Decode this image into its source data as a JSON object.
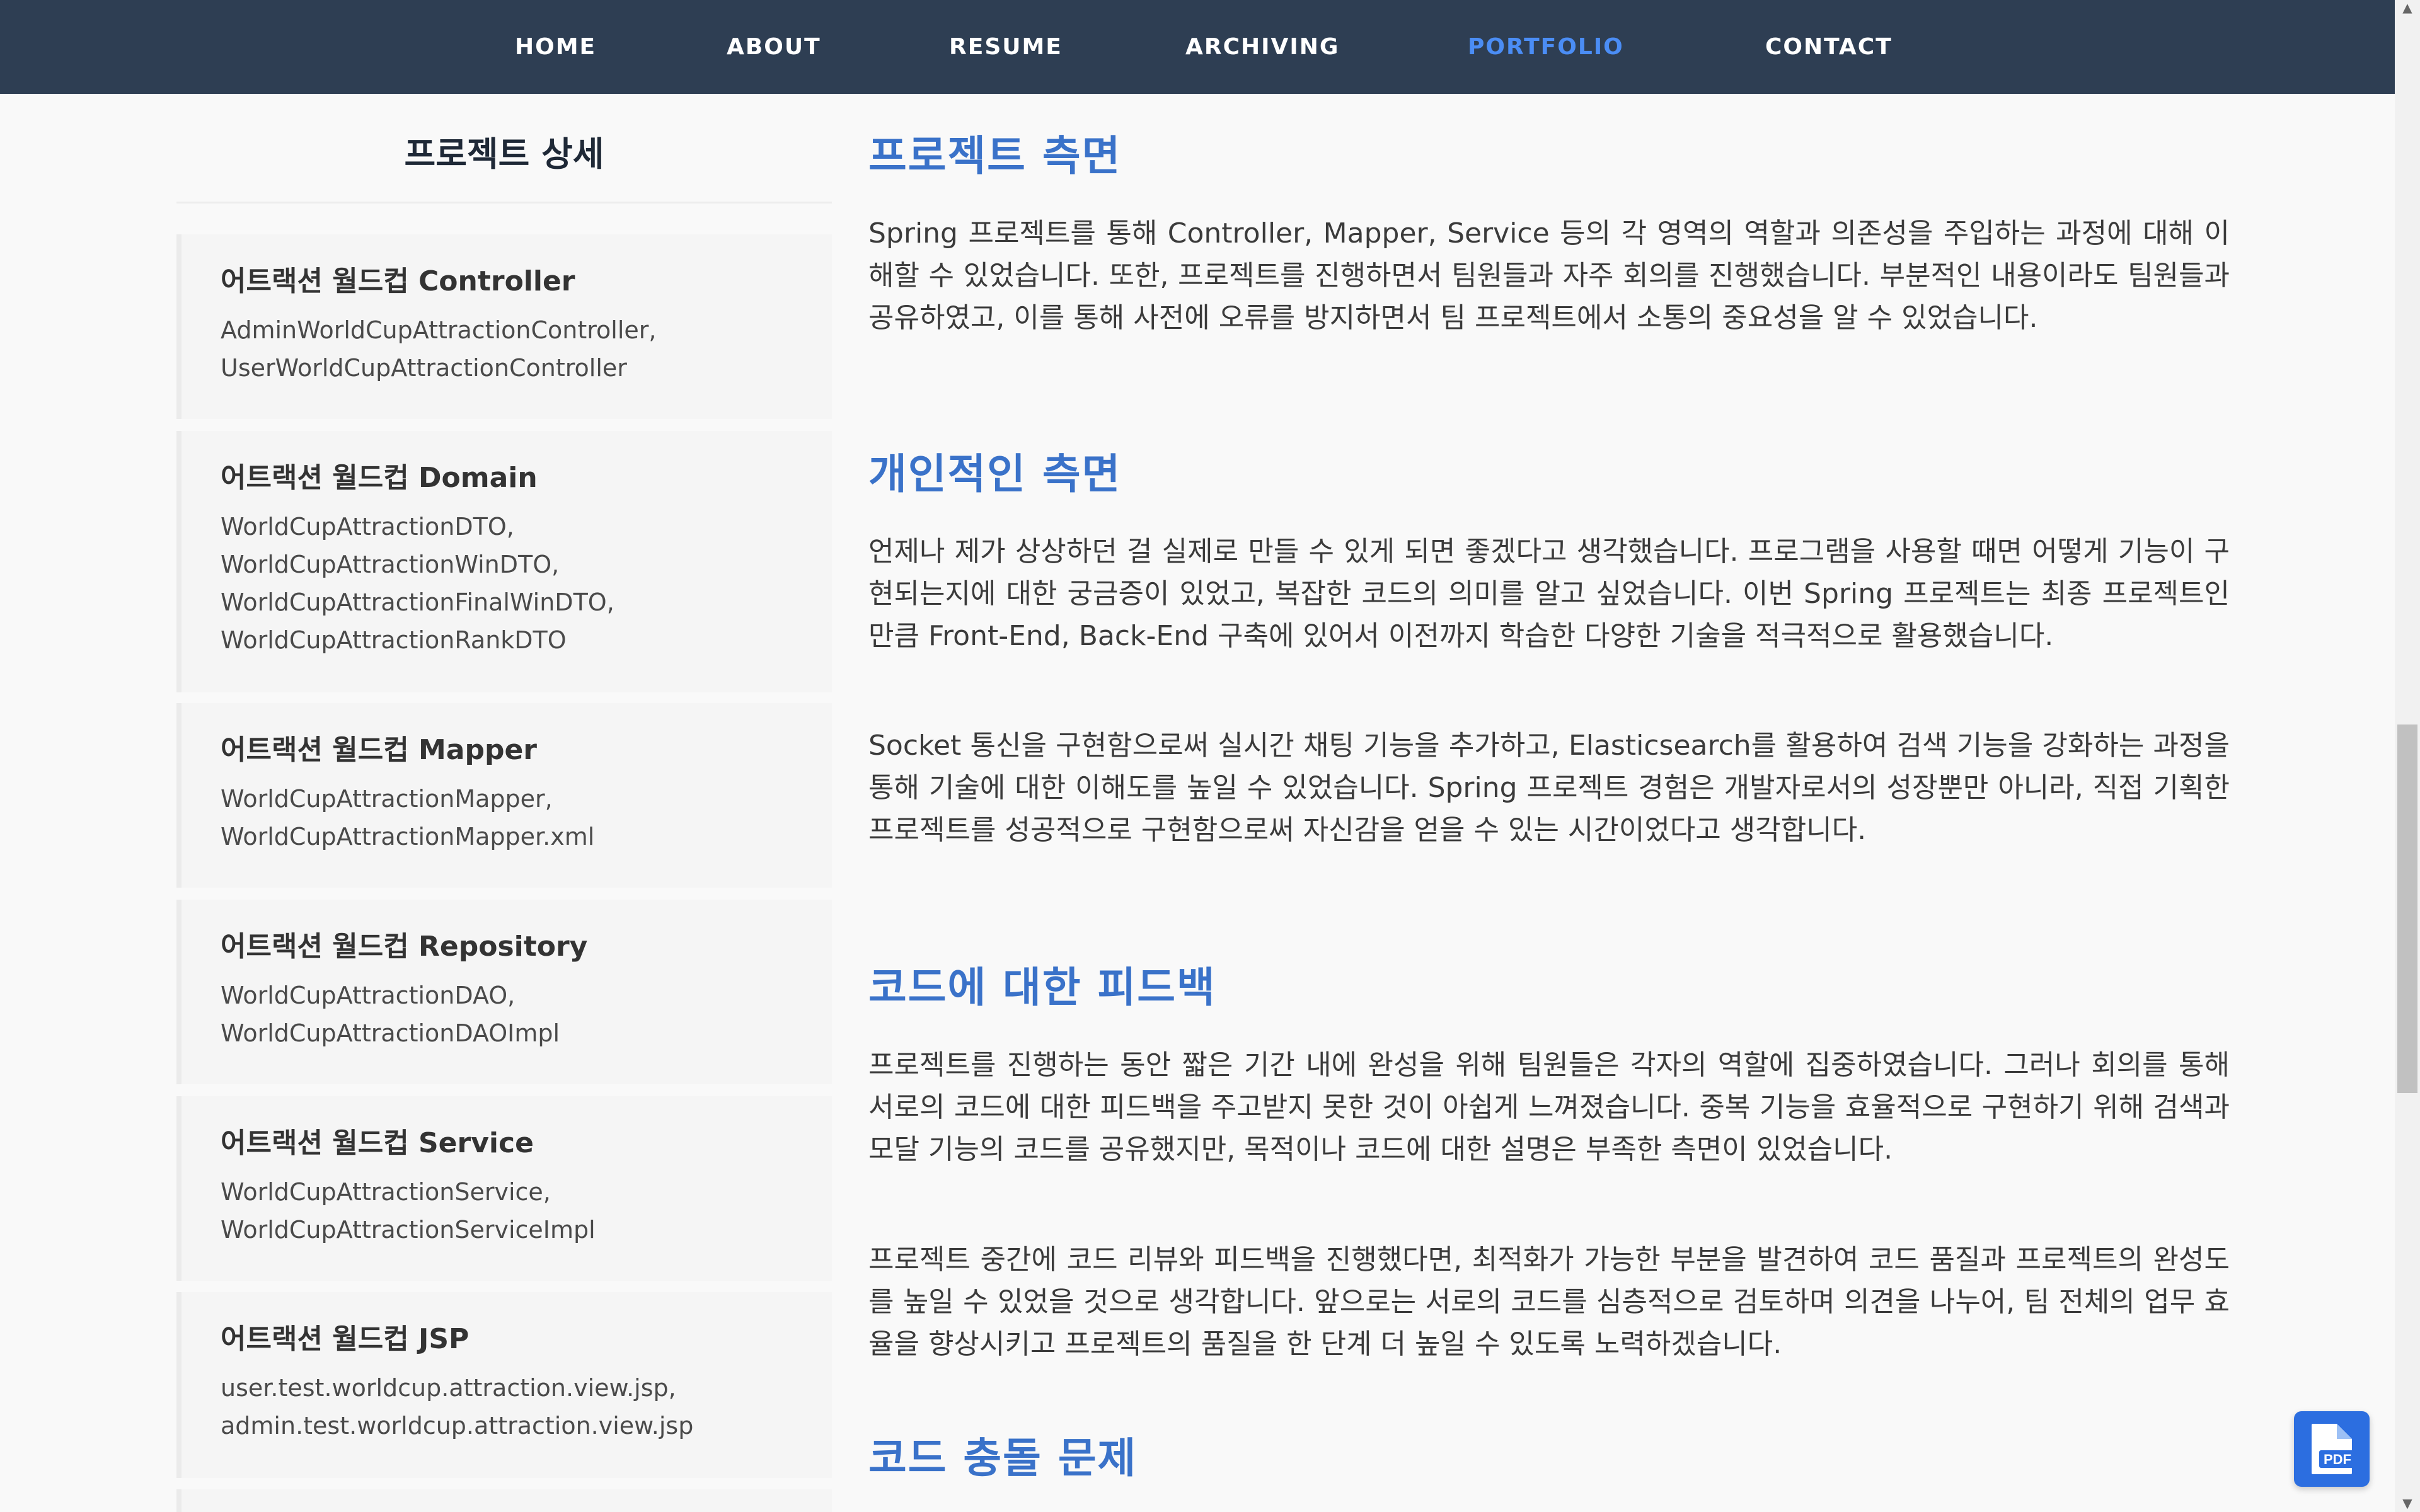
{
  "nav": {
    "items": [
      "HOME",
      "ABOUT",
      "RESUME",
      "ARCHIVING",
      "PORTFOLIO",
      "CONTACT"
    ],
    "active": "PORTFOLIO",
    "active_color": "#4b8df5",
    "bg_color": "#2e3e53"
  },
  "sidebar": {
    "title": "프로젝트 상세",
    "cards": [
      {
        "title": "어트랙션 월드컵 Controller",
        "lines": [
          "AdminWorldCupAttractionController,",
          "UserWorldCupAttractionController"
        ]
      },
      {
        "title": "어트랙션 월드컵 Domain",
        "lines": [
          "WorldCupAttractionDTO,",
          "WorldCupAttractionWinDTO,",
          "WorldCupAttractionFinalWinDTO,",
          "WorldCupAttractionRankDTO"
        ]
      },
      {
        "title": "어트랙션 월드컵 Mapper",
        "lines": [
          "WorldCupAttractionMapper,",
          "WorldCupAttractionMapper.xml"
        ]
      },
      {
        "title": "어트랙션 월드컵 Repository",
        "lines": [
          "WorldCupAttractionDAO,",
          "WorldCupAttractionDAOImpl"
        ]
      },
      {
        "title": "어트랙션 월드컵 Service",
        "lines": [
          "WorldCupAttractionService,",
          "WorldCupAttractionServiceImpl"
        ]
      },
      {
        "title": "어트랙션 월드컵 JSP",
        "lines": [
          "user.test.worldcup.attraction.view.jsp,",
          "admin.test.worldcup.attraction.view.jsp"
        ]
      }
    ]
  },
  "main": {
    "sections": [
      {
        "heading": "프로젝트 측면",
        "paragraphs": [
          "Spring 프로젝트를 통해 Controller, Mapper, Service 등의 각 영역의 역할과 의존성을 주입하는 과정에 대해 이해할 수 있었습니다. 또한, 프로젝트를 진행하면서 팀원들과 자주 회의를 진행했습니다. 부분적인 내용이라도 팀원들과 공유하였고, 이를 통해 사전에 오류를 방지하면서 팀 프로젝트에서 소통의 중요성을 알 수 있었습니다."
        ]
      },
      {
        "heading": "개인적인 측면",
        "paragraphs": [
          "언제나 제가 상상하던 걸 실제로 만들 수 있게 되면 좋겠다고 생각했습니다. 프로그램을 사용할 때면 어떻게 기능이 구현되는지에 대한 궁금증이 있었고, 복잡한 코드의 의미를 알고 싶었습니다. 이번 Spring 프로젝트는 최종 프로젝트인 만큼 Front-End, Back-End 구축에 있어서 이전까지 학습한 다양한 기술을 적극적으로 활용했습니다.",
          "Socket 통신을 구현함으로써 실시간 채팅 기능을 추가하고, Elasticsearch를 활용하여 검색 기능을 강화하는 과정을 통해 기술에 대한 이해도를 높일 수 있었습니다. Spring 프로젝트 경험은 개발자로서의 성장뿐만 아니라, 직접 기획한 프로젝트를 성공적으로 구현함으로써 자신감을 얻을 수 있는 시간이었다고 생각합니다."
        ]
      },
      {
        "heading": "코드에 대한 피드백",
        "paragraphs": [
          "프로젝트를 진행하는 동안 짧은 기간 내에 완성을 위해 팀원들은 각자의 역할에 집중하였습니다. 그러나 회의를 통해 서로의 코드에 대한 피드백을 주고받지 못한 것이 아쉽게 느껴졌습니다. 중복 기능을 효율적으로 구현하기 위해 검색과 모달 기능의 코드를 공유했지만, 목적이나 코드에 대한 설명은 부족한 측면이 있었습니다.",
          "프로젝트 중간에 코드 리뷰와 피드백을 진행했다면, 최적화가 가능한 부분을 발견하여 코드 품질과 프로젝트의 완성도를 높일 수 있었을 것으로 생각합니다. 앞으로는 서로의 코드를 심층적으로 검토하며 의견을 나누어, 팀 전체의 업무 효율을 향상시키고 프로젝트의 품질을 한 단계 더 높일 수 있도록 노력하겠습니다."
        ]
      },
      {
        "heading": "코드 충돌 문제",
        "paragraphs": []
      }
    ]
  },
  "pdf_button": {
    "label": "PDF",
    "icon": "pdf-file-icon",
    "color": "#2c6ee0"
  }
}
